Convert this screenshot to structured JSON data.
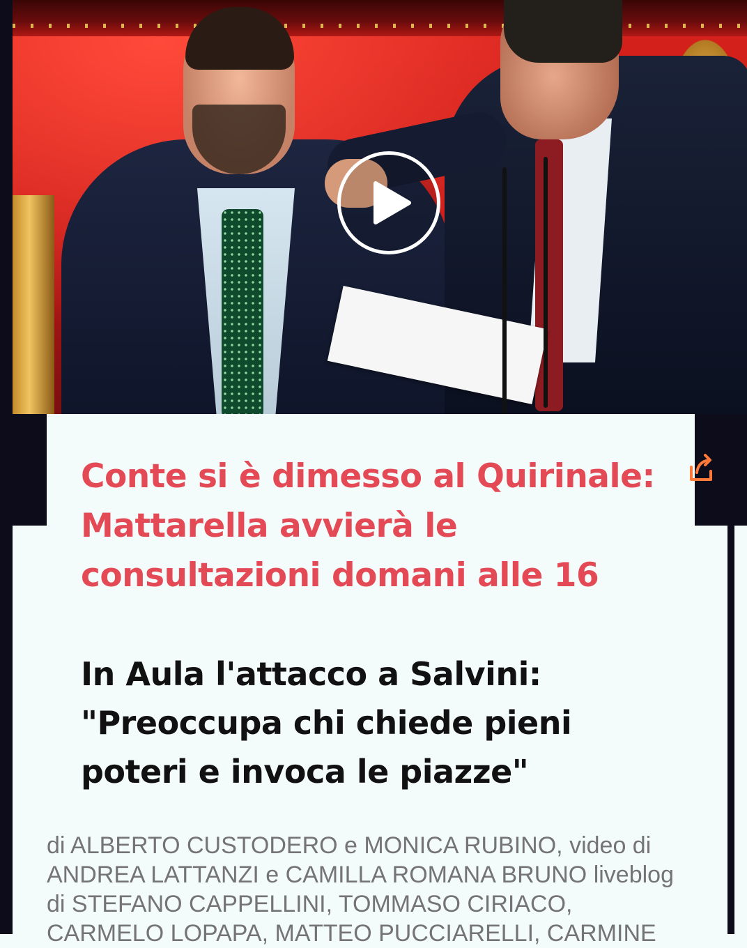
{
  "article": {
    "headline": "Conte si è dimesso al Quirinale: Mattarella avvierà le consultazioni domani alle 16",
    "subheadline": "In Aula l'attacco a Salvini: \"Preoccupa chi chiede pieni poteri e invoca le piazze\"",
    "byline": "di ALBERTO CUSTODERO e MONICA RUBINO, video di ANDREA LATTANZI e CAMILLA ROMANA BRUNO liveblog di STEFANO CAPPELLINI, TOMMASO CIRIACO, CARMELO LOPAPA, MATTEO PUCCIARELLI, CARMINE"
  },
  "media": {
    "play_icon": "play-icon",
    "share_icon": "share-icon"
  },
  "colors": {
    "headline": "#e34a55",
    "subheadline": "#111111",
    "byline": "#747474",
    "background": "#f4fbfb",
    "dark": "#0c0c1a"
  }
}
